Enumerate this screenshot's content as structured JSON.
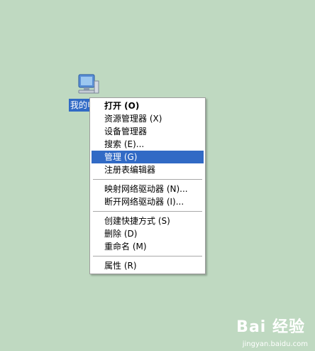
{
  "desktop": {
    "icon": {
      "name": "computer-icon",
      "label": "我的电脑"
    }
  },
  "context_menu": {
    "groups": [
      [
        {
          "label": "打开 (O)",
          "bold": true
        },
        {
          "label": "资源管理器 (X)"
        },
        {
          "label": "设备管理器"
        },
        {
          "label": "搜索 (E)..."
        },
        {
          "label": "管理 (G)",
          "highlighted": true
        },
        {
          "label": "注册表编辑器"
        }
      ],
      [
        {
          "label": "映射网络驱动器 (N)..."
        },
        {
          "label": "断开网络驱动器 (I)..."
        }
      ],
      [
        {
          "label": "创建快捷方式 (S)"
        },
        {
          "label": "删除 (D)"
        },
        {
          "label": "重命名 (M)"
        }
      ],
      [
        {
          "label": "属性 (R)"
        }
      ]
    ]
  },
  "watermark": {
    "logo": "Bai 经验",
    "site": "jingyan.baidu.com"
  },
  "colors": {
    "desktop": "#bfd9c1",
    "selection": "#316ac5"
  }
}
